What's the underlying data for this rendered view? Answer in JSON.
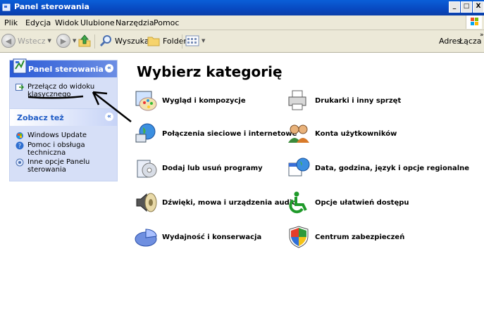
{
  "window": {
    "title": "Panel sterowania",
    "buttons": [
      "_",
      "□",
      "X"
    ]
  },
  "menu": [
    "Plik",
    "Edycja",
    "Widok",
    "Ulubione",
    "Narzędzia",
    "Pomoc"
  ],
  "toolbar": {
    "back": "Wstecz",
    "search": "Wyszukaj",
    "folders": "Foldery",
    "address": "Adres",
    "links": "Łącza"
  },
  "leftpane": {
    "control_panel_box": {
      "title": "Panel sterowania",
      "switch_view": "Przełącz do widoku klasycznego"
    },
    "see_also_box": {
      "title": "Zobacz też",
      "items": [
        "Windows Update",
        "Pomoc i obsługa techniczna",
        "Inne opcje Panelu sterowania"
      ]
    }
  },
  "main": {
    "heading": "Wybierz kategorię",
    "categories": [
      "Wygląd i kompozycje",
      "Drukarki i inny sprzęt",
      "Połączenia sieciowe i internetowe",
      "Konta użytkowników",
      "Dodaj lub usuń programy",
      "Data, godzina, język i opcje regionalne",
      "Dźwięki, mowa i urządzenia audio",
      "Opcje ułatwień dostępu",
      "Wydajność i konserwacja",
      "Centrum zabezpieczeń"
    ]
  }
}
